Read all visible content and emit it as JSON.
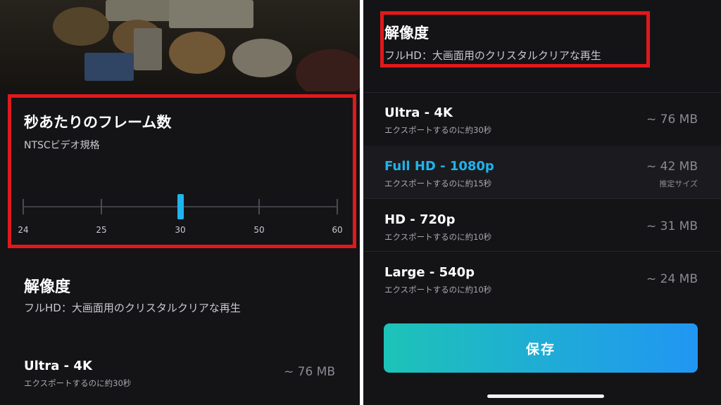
{
  "left": {
    "fps": {
      "title": "秒あたりのフレーム数",
      "subtitle": "NTSCビデオ規格",
      "ticks": [
        "24",
        "25",
        "30",
        "50",
        "60"
      ],
      "selected": "30"
    },
    "resolution": {
      "title": "解像度",
      "subtitle": "フルHD：大画面用のクリスタルクリアな再生"
    },
    "option": {
      "name": "Ultra - 4K",
      "note": "エクスポートするのに約30秒",
      "size": "~ 76 MB"
    }
  },
  "right": {
    "resolution": {
      "title": "解像度",
      "subtitle": "フルHD：大画面用のクリスタルクリアな再生"
    },
    "options": [
      {
        "name": "Ultra - 4K",
        "note": "エクスポートするのに約30秒",
        "size": "~ 76 MB",
        "hint": ""
      },
      {
        "name": "Full HD - 1080p",
        "note": "エクスポートするのに約15秒",
        "size": "~ 42 MB",
        "hint": "推定サイズ"
      },
      {
        "name": "HD - 720p",
        "note": "エクスポートするのに約10秒",
        "size": "~ 31 MB",
        "hint": ""
      },
      {
        "name": "Large - 540p",
        "note": "エクスポートするのに約10秒",
        "size": "~ 24 MB",
        "hint": ""
      }
    ],
    "selected_index": 1,
    "save_label": "保存"
  },
  "colors": {
    "background": "#141417",
    "accent": "#1fb4ec",
    "highlight_border": "#e0191b",
    "save_gradient": [
      "#1dc3b7",
      "#2196f3"
    ]
  }
}
